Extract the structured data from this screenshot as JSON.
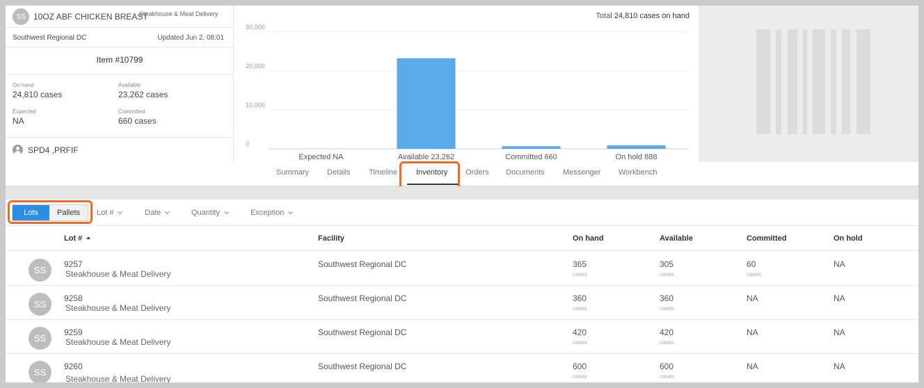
{
  "item": {
    "avatar": "SS",
    "name": "10OZ ABF CHICKEN BREAST",
    "vendor": "Steakhouse & Meat Delivery",
    "facility": "Southwest Regional DC",
    "updated": "Updated Jun 2, 08:01",
    "item_number": "Item #10799",
    "on_hand_label": "On hand",
    "on_hand_value": "24,810 cases",
    "available_label": "Available",
    "available_value": "23,262 cases",
    "expected_label": "Expected",
    "expected_value": "NA",
    "committed_label": "Committed",
    "committed_value": "660 cases",
    "user": "SPD4 ,PRFIF"
  },
  "chart_total": {
    "prefix": "Total",
    "value": "24,810 cases on hand"
  },
  "chart_data": {
    "type": "bar",
    "categories": [
      "Expected",
      "Available",
      "Committed",
      "On hold"
    ],
    "values": [
      0,
      23262,
      660,
      888
    ],
    "category_labels": [
      "Expected NA",
      "Available 23,262",
      "Committed 660",
      "On hold 888"
    ],
    "y_ticks": [
      "0",
      "10,000",
      "20,000",
      "30,000"
    ],
    "ylim": [
      0,
      30000
    ],
    "bar_color": "#5aaaea",
    "grid": true
  },
  "tabs": [
    {
      "label": "Summary"
    },
    {
      "label": "Details"
    },
    {
      "label": "Timeline"
    },
    {
      "label": "Inventory"
    },
    {
      "label": "Orders"
    },
    {
      "label": "Documents"
    },
    {
      "label": "Messenger"
    },
    {
      "label": "Workbench"
    }
  ],
  "active_tab": "Inventory",
  "filter": {
    "segments": [
      "Lots",
      "Pallets"
    ],
    "selected_segment": "Lots",
    "dropdowns": [
      "Lot #",
      "Date",
      "Quantity",
      "Exception"
    ]
  },
  "table": {
    "columns": [
      "Lot #",
      "Facility",
      "On hand",
      "Available",
      "Committed",
      "On hold"
    ],
    "unit": "cases",
    "rows": [
      {
        "avatar": "SS",
        "lot": "9257",
        "vendor": "Steakhouse & Meat Delivery",
        "facility": "Southwest Regional DC",
        "on_hand": "365",
        "available": "305",
        "committed": "60",
        "on_hold": "NA"
      },
      {
        "avatar": "SS",
        "lot": "9258",
        "vendor": "Steakhouse & Meat Delivery",
        "facility": "Southwest Regional DC",
        "on_hand": "360",
        "available": "360",
        "committed": "NA",
        "on_hold": "NA"
      },
      {
        "avatar": "SS",
        "lot": "9259",
        "vendor": "Steakhouse & Meat Delivery",
        "facility": "Southwest Regional DC",
        "on_hand": "420",
        "available": "420",
        "committed": "NA",
        "on_hold": "NA"
      },
      {
        "avatar": "SS",
        "lot": "9260",
        "vendor": "Steakhouse & Meat Delivery",
        "facility": "Southwest Regional DC",
        "on_hand": "600",
        "available": "600",
        "committed": "NA",
        "on_hold": "NA"
      }
    ]
  },
  "colors": {
    "accent": "#2d8de4",
    "highlight": "#f06b23",
    "bar": "#5aaaea"
  }
}
